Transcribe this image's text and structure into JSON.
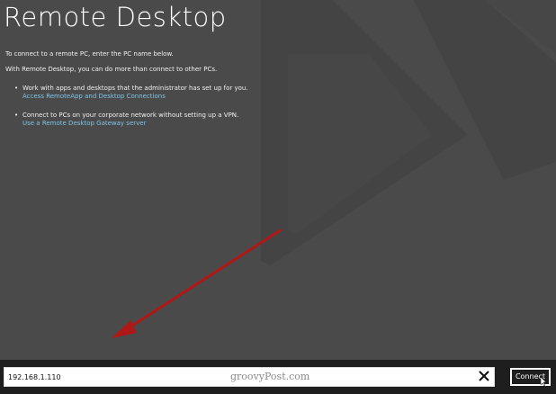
{
  "app": {
    "title": "Remote Desktop"
  },
  "content": {
    "intro": "To connect to a remote PC, enter the PC name below.",
    "intro2": "With Remote Desktop, you can do more than connect to other PCs.",
    "bullets": [
      {
        "text": "Work with apps and desktops that the administrator has set up for you.",
        "link": "Access RemoteApp and Desktop Connections"
      },
      {
        "text": "Connect to PCs on your corporate network without setting up a VPN.",
        "link": "Use a Remote Desktop Gateway server"
      }
    ]
  },
  "connect_bar": {
    "pc_name_value": "192.168.1.110",
    "connect_label": "Connect"
  },
  "watermark": "groovyPost.com",
  "annotation": {
    "arrow_color": "#b01818"
  },
  "icons": {
    "clear": "close-icon",
    "bullet": "bullet-dot",
    "cursor": "mouse-pointer-icon"
  },
  "colors": {
    "background": "#4a4a4a",
    "bar": "#1e1e1e",
    "link": "#7fc4e8"
  }
}
